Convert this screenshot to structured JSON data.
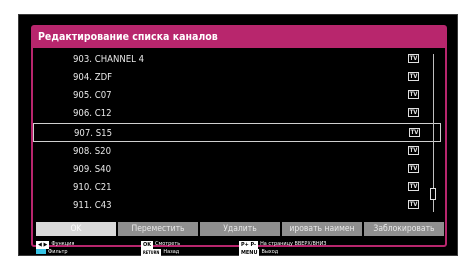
{
  "dialog": {
    "title": "Редактирование списка каналов"
  },
  "channels": [
    {
      "label": "903. CHANNEL 4",
      "type": "TV"
    },
    {
      "label": "904. ZDF",
      "type": "TV"
    },
    {
      "label": "905. C07",
      "type": "TV"
    },
    {
      "label": "906. C12",
      "type": "TV"
    },
    {
      "label": "907. S15",
      "type": "TV",
      "selected": true
    },
    {
      "label": "908. S20",
      "type": "TV"
    },
    {
      "label": "909. S40",
      "type": "TV"
    },
    {
      "label": "910. C21",
      "type": "TV"
    },
    {
      "label": "911. C43",
      "type": "TV"
    }
  ],
  "scroll": {
    "position": 0.92
  },
  "buttons": [
    {
      "label": "OK",
      "active": true
    },
    {
      "label": "Переместить"
    },
    {
      "label": "Удалить"
    },
    {
      "label": "ировать наимен"
    },
    {
      "label": "Заблокировать"
    }
  ],
  "legend": {
    "function_key": "◀ ▶",
    "function_label": "Функция",
    "filter_label": "Фильтр",
    "ok_key": "OK",
    "ok_label": "Смотреть",
    "return_key": "RETURN",
    "return_label": "Назад",
    "page_key": "P+ P-",
    "page_label": "На страницу ВВЕРХ/ВНИЗ",
    "menu_key": "MENU",
    "menu_label": "Выход"
  },
  "colors": {
    "accent": "#b8266d",
    "filter_blue": "#37c4e6",
    "button_grey": "#8f8f8f"
  }
}
